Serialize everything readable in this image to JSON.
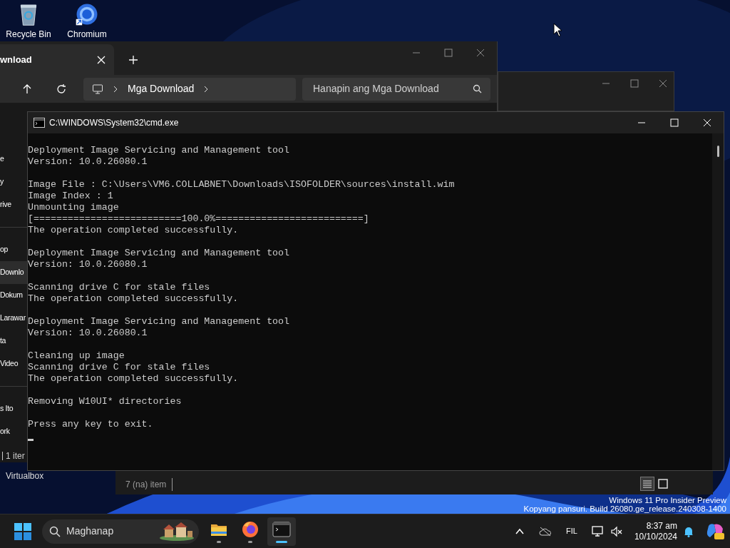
{
  "desktop_icons": [
    {
      "kind": "bin",
      "label": "Recycle Bin"
    },
    {
      "kind": "browser",
      "label": "Chromium"
    }
  ],
  "hidden_desktop_icon": {
    "lines": [
      "Virtualbox"
    ]
  },
  "back_explorer": {
    "status": "7 (na) item"
  },
  "explorer": {
    "tab": "wnload",
    "address": "Mga Download",
    "search_placeholder": "Hanapin ang Mga Download",
    "sidebar": [
      {
        "label": "e",
        "selected": false
      },
      {
        "label": "y",
        "selected": false
      },
      {
        "label": "rive",
        "selected": false
      },
      {
        "label": "op",
        "selected": false
      },
      {
        "label": "Downlo",
        "selected": true
      },
      {
        "label": "Dokum",
        "selected": false
      },
      {
        "label": "Larawar",
        "selected": false
      },
      {
        "label": "ta",
        "selected": false
      },
      {
        "label": "Video",
        "selected": false
      },
      {
        "label": "s Ito",
        "selected": false
      },
      {
        "label": "ork",
        "selected": false
      }
    ],
    "status": "1 iter"
  },
  "cmd": {
    "title": "C:\\WINDOWS\\System32\\cmd.exe",
    "blocks": [
      [
        "Deployment Image Servicing and Management tool",
        "Version: 10.0.26080.1"
      ],
      [
        "Image File : C:\\Users\\VM6.COLLABNET\\Downloads\\ISOFOLDER\\sources\\install.wim",
        "Image Index : 1",
        "Unmounting image",
        "[==========================100.0%==========================]",
        "The operation completed successfully."
      ],
      [
        "Deployment Image Servicing and Management tool",
        "Version: 10.0.26080.1"
      ],
      [
        "Scanning drive C for stale files",
        "The operation completed successfully."
      ],
      [
        "Deployment Image Servicing and Management tool",
        "Version: 10.0.26080.1"
      ],
      [
        "Cleaning up image",
        "Scanning drive C for stale files",
        "The operation completed successfully."
      ],
      [
        "Removing W10UI* directories"
      ],
      [
        "Press any key to exit."
      ]
    ]
  },
  "os_notice": [
    "Windows 11 Pro Insider Preview",
    "Kopyang pansuri. Build 26080.ge_release.240308-1400"
  ],
  "taskbar": {
    "search_placeholder": "Maghanap",
    "apps": [
      {
        "kind": "explorer",
        "selected": false
      },
      {
        "kind": "firefox",
        "selected": false
      },
      {
        "kind": "terminal",
        "selected": true
      }
    ],
    "language": "FIL",
    "time": "8:37 am",
    "date": "10/10/2024"
  }
}
